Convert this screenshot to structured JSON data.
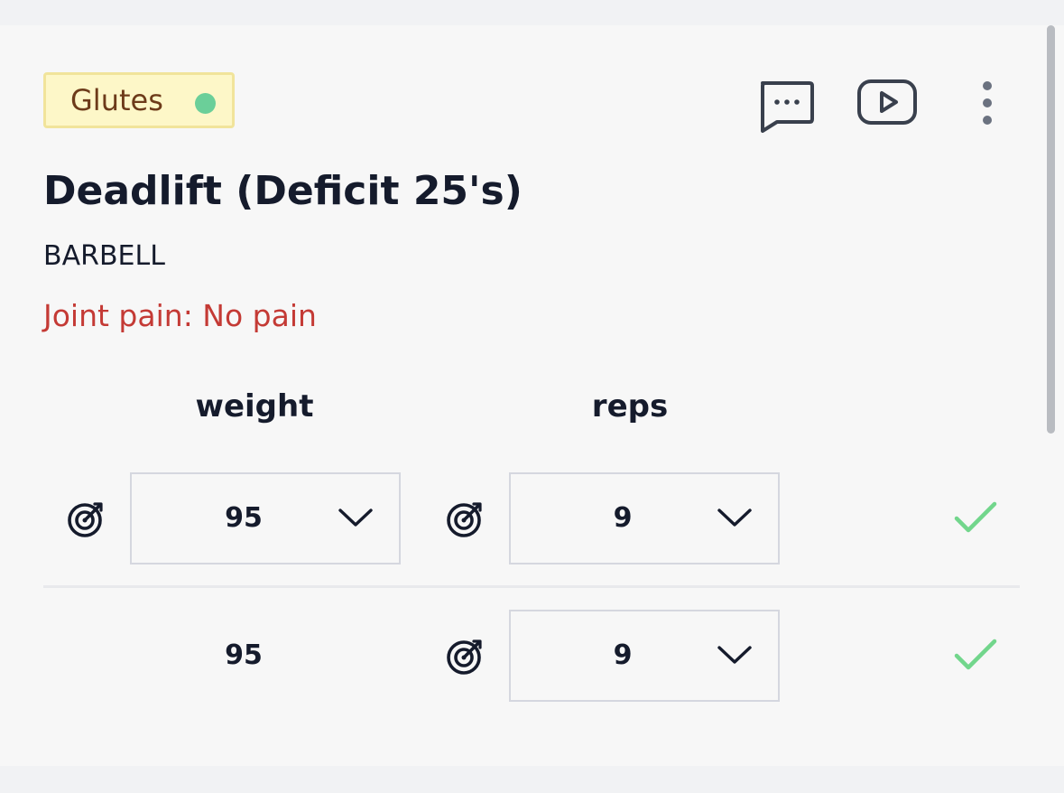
{
  "exercise": {
    "muscle_tag": "Glutes",
    "title": "Deadlift (Deficit 25's)",
    "equipment": "BARBELL",
    "note": "Joint pain: No pain"
  },
  "actions": {
    "icons": [
      "comment-icon",
      "video-icon",
      "more-vertical-icon"
    ]
  },
  "columns": {
    "weight": "weight",
    "reps": "reps"
  },
  "sets": [
    {
      "weight": "95",
      "reps": "9",
      "weight_editable": true,
      "reps_editable": true,
      "completed": true
    },
    {
      "weight": "95",
      "reps": "9",
      "weight_editable": false,
      "reps_editable": true,
      "completed": true
    }
  ],
  "colors": {
    "tag_bg": "#fdf7c8",
    "tag_border": "#f1e49b",
    "tag_text": "#6d3b1a",
    "tag_dot": "#6bcf99",
    "note_text": "#c43a35",
    "check": "#72d68c",
    "card_bg": "#f7f7f7",
    "page_bg": "#f1f2f4"
  }
}
